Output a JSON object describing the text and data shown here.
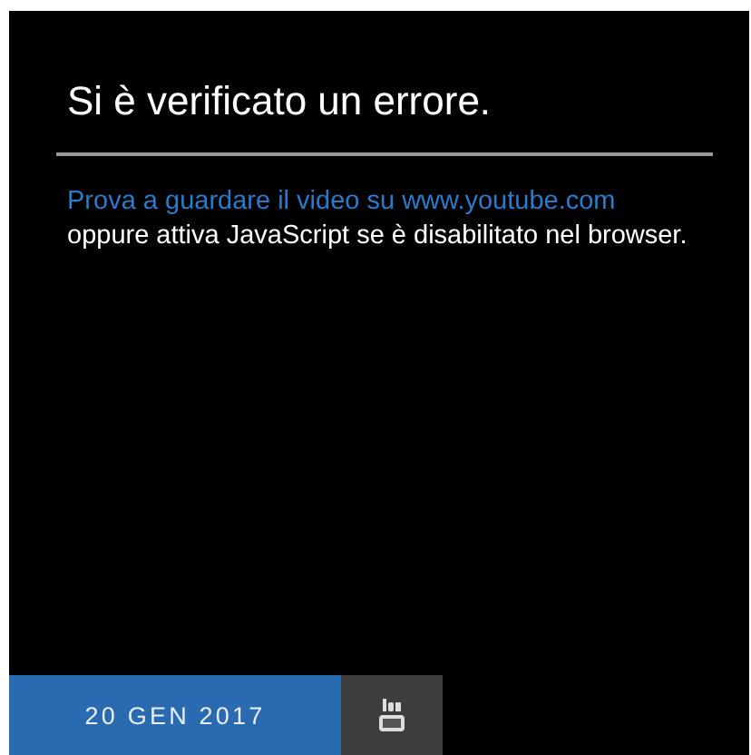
{
  "error": {
    "title": "Si è verificato un errore.",
    "link": "Prova a guardare il video su www.youtube.com",
    "message": "oppure attiva JavaScript se è disabilitato nel browser."
  },
  "footer": {
    "date": "20 GEN 2017"
  }
}
